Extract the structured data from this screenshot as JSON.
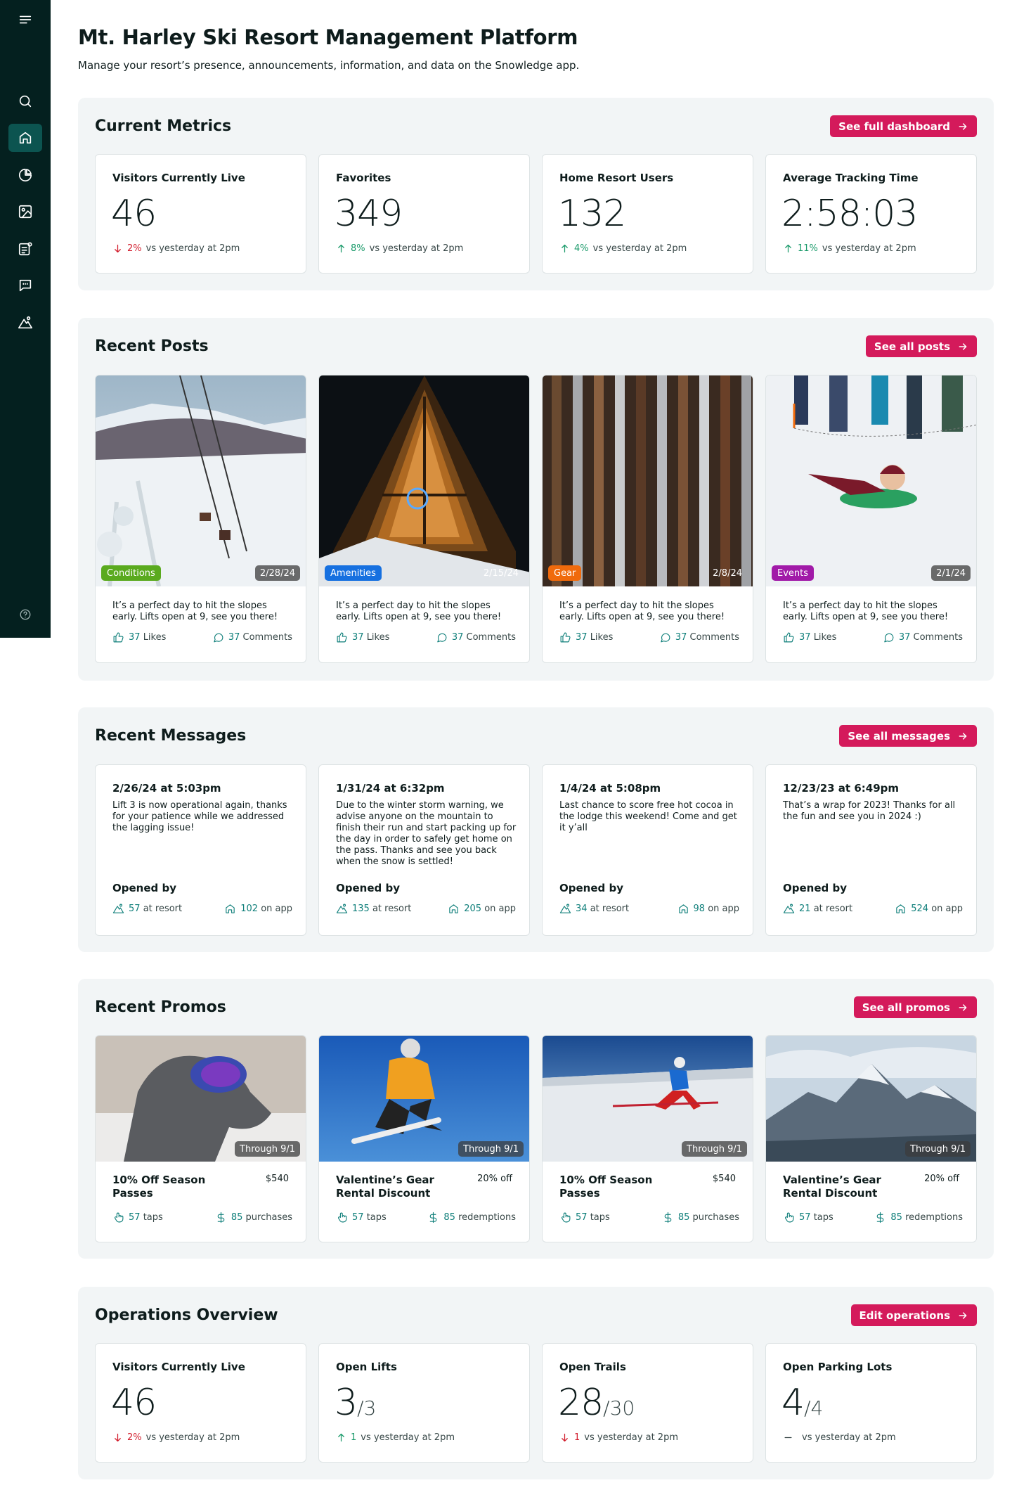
{
  "sidebar": {
    "items": [
      {
        "icon": "menu-icon"
      },
      {
        "icon": "search-icon"
      },
      {
        "icon": "home-icon",
        "active": true
      },
      {
        "icon": "pie-chart-icon"
      },
      {
        "icon": "image-icon"
      },
      {
        "icon": "announcement-icon"
      },
      {
        "icon": "message-icon"
      },
      {
        "icon": "mountain-icon"
      },
      {
        "icon": "help-icon"
      }
    ]
  },
  "page": {
    "title": "Mt. Harley Ski Resort Management Platform",
    "subtitle": "Manage your resort’s presence, announcements, information, and data on the Snowledge app."
  },
  "colors": {
    "accent": "#d41a5b",
    "sidebar": "#04201f",
    "teal": "#0f7f7a",
    "up": "#1a9a6a",
    "down": "#d21c2c"
  },
  "metrics": {
    "title": "Current Metrics",
    "button": "See full dashboard",
    "cards": [
      {
        "label": "Visitors Currently Live",
        "value": "46",
        "trend": "down",
        "pct": "2%",
        "compare": "vs yesterday at 2pm"
      },
      {
        "label": "Favorites",
        "value": "349",
        "trend": "up",
        "pct": "8%",
        "compare": "vs yesterday at 2pm"
      },
      {
        "label": "Home Resort Users",
        "value": "132",
        "trend": "up",
        "pct": "4%",
        "compare": "vs yesterday at 2pm"
      },
      {
        "label": "Average Tracking Time",
        "value": "2:58:03",
        "trend": "up",
        "pct": "11%",
        "compare": "vs yesterday at 2pm"
      }
    ]
  },
  "posts": {
    "title": "Recent Posts",
    "button": "See all posts",
    "items": [
      {
        "tag": "Conditions",
        "tag_color": "#5aaa1e",
        "date": "2/28/24",
        "text": "It’s a perfect day to hit the slopes early. Lifts open at 9, see you there!",
        "likes": "37",
        "likes_label": "Likes",
        "comments": "37",
        "comments_label": "Comments"
      },
      {
        "tag": "Amenities",
        "tag_color": "#1670e0",
        "date": "2/15/24",
        "text": "It’s a perfect day to hit the slopes early. Lifts open at 9, see you there!",
        "likes": "37",
        "likes_label": "Likes",
        "comments": "37",
        "comments_label": "Comments"
      },
      {
        "tag": "Gear",
        "tag_color": "#f06a0c",
        "date": "2/8/24",
        "text": "It’s a perfect day to hit the slopes early. Lifts open at 9, see you there!",
        "likes": "37",
        "likes_label": "Likes",
        "comments": "37",
        "comments_label": "Comments"
      },
      {
        "tag": "Events",
        "tag_color": "#a11aa8",
        "date": "2/1/24",
        "text": "It’s a perfect day to hit the slopes early. Lifts open at 9, see you there!",
        "likes": "37",
        "likes_label": "Likes",
        "comments": "37",
        "comments_label": "Comments"
      }
    ]
  },
  "messages": {
    "title": "Recent Messages",
    "button": "See all messages",
    "opened_label": "Opened by",
    "items": [
      {
        "date": "2/26/24 at 5:03pm",
        "text": "Lift 3 is now operational again, thanks for your patience while we addressed the lagging issue!",
        "resort": "57",
        "resort_label": "at resort",
        "app": "102",
        "app_label": "on app"
      },
      {
        "date": "1/31/24 at 6:32pm",
        "text": "Due to the winter storm warning, we advise anyone on the mountain to finish their run and start packing up for the day in order to safely get home on the pass. Thanks and see you back when the snow is settled!",
        "resort": "135",
        "resort_label": "at resort",
        "app": "205",
        "app_label": "on app"
      },
      {
        "date": "1/4/24 at 5:08pm",
        "text": "Last chance to score free hot cocoa in the lodge this weekend! Come and get it y’all",
        "resort": "34",
        "resort_label": "at resort",
        "app": "98",
        "app_label": "on app"
      },
      {
        "date": "12/23/23 at 6:49pm",
        "text": "That’s a wrap for 2023! Thanks for all the fun and see you in 2024 :)",
        "resort": "21",
        "resort_label": "at resort",
        "app": "524",
        "app_label": "on app"
      }
    ]
  },
  "promos": {
    "title": "Recent Promos",
    "button": "See all promos",
    "items": [
      {
        "through": "Through 9/1",
        "title": "10% Off Season Passes",
        "price": "$540",
        "taps": "57",
        "taps_label": "taps",
        "count": "85",
        "count_label": "purchases"
      },
      {
        "through": "Through 9/1",
        "title": "Valentine’s Gear Rental Discount",
        "price": "20% off",
        "taps": "57",
        "taps_label": "taps",
        "count": "85",
        "count_label": "redemptions"
      },
      {
        "through": "Through 9/1",
        "title": "10% Off Season Passes",
        "price": "$540",
        "taps": "57",
        "taps_label": "taps",
        "count": "85",
        "count_label": "purchases"
      },
      {
        "through": "Through 9/1",
        "title": "Valentine’s Gear Rental Discount",
        "price": "20% off",
        "taps": "57",
        "taps_label": "taps",
        "count": "85",
        "count_label": "redemptions"
      }
    ]
  },
  "operations": {
    "title": "Operations Overview",
    "button": "Edit operations",
    "cards": [
      {
        "label": "Visitors Currently Live",
        "value": "46",
        "denominator": "",
        "trend": "down",
        "pct": "2%",
        "compare": "vs yesterday at 2pm"
      },
      {
        "label": "Open Lifts",
        "value": "3",
        "denominator": "/3",
        "trend": "up",
        "pct": "1",
        "compare": "vs yesterday at 2pm"
      },
      {
        "label": "Open Trails",
        "value": "28",
        "denominator": "/30",
        "trend": "down",
        "pct": "1",
        "compare": "vs yesterday at 2pm"
      },
      {
        "label": "Open Parking Lots",
        "value": "4",
        "denominator": "/4",
        "trend": "flat",
        "pct": "",
        "compare": "vs yesterday at 2pm"
      }
    ]
  }
}
